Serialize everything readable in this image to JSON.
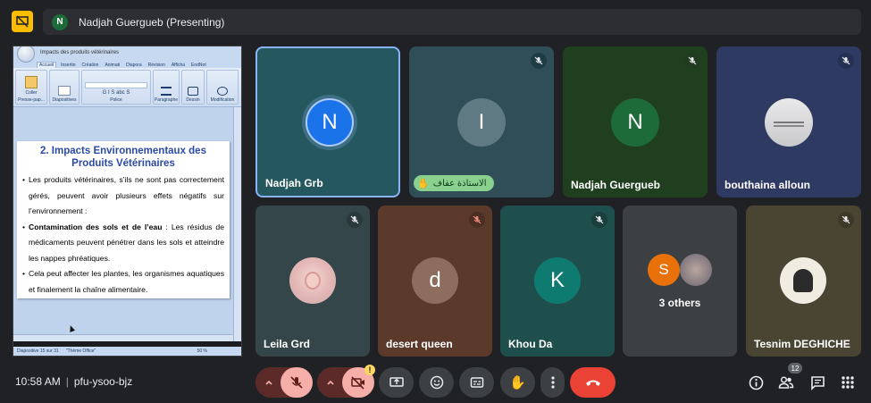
{
  "presenter": {
    "initial": "N",
    "banner": "Nadjah Guergueb (Presenting)"
  },
  "slide": {
    "window_title": "Impacts des produits vétérinaires",
    "tabs": [
      "Accueil",
      "Insertio",
      "Création",
      "Animati",
      "Diapora",
      "Révision",
      "Afficha",
      "EndNot"
    ],
    "groups": [
      "Coller",
      "Diapositives",
      "Police",
      "Paragraphe",
      "Dessin",
      "Modification"
    ],
    "group_captions": [
      "Presse-pap...",
      "",
      "Police",
      "",
      "",
      ""
    ],
    "title_line1": "2. Impacts Environnementaux des",
    "title_line2": "Produits Vétérinaires",
    "bullets": [
      {
        "bold": "",
        "text": "Les produits vétérinaires, s’ils ne sont pas correctement gérés, peuvent avoir plusieurs effets négatifs sur l’environnement :"
      },
      {
        "bold": "Contamination des sols et de l’eau",
        "text": " : Les résidus de médicaments peuvent pénétrer dans les sols et atteindre les nappes phréatiques."
      },
      {
        "bold": "",
        "text": "Cela peut affecter les plantes, les organismes aquatiques et finalement la chaîne alimentaire."
      }
    ],
    "status_left": "Diapositive 15 sur 31",
    "status_theme": "\"Thème Office\"",
    "status_zoom": "50 %"
  },
  "tiles": [
    {
      "name": "Nadjah Grb",
      "initial": "N",
      "muted": false,
      "active": true
    },
    {
      "name": "",
      "initial": "I",
      "muted": true,
      "hand_label": "الاستاذة عفاف"
    },
    {
      "name": "Nadjah Guergueb",
      "initial": "N",
      "muted": true
    },
    {
      "name": "bouthaina alloun",
      "initial": "",
      "muted": true
    },
    {
      "name": "Leila Grd",
      "initial": "",
      "muted": true
    },
    {
      "name": "desert queen",
      "initial": "d",
      "muted": true
    },
    {
      "name": "Khou Da",
      "initial": "K",
      "muted": true
    },
    {
      "name": "3 others",
      "initial": "S",
      "muted": false
    },
    {
      "name": "Tesnim DEGHICHE",
      "initial": "",
      "muted": true
    }
  ],
  "meeting": {
    "time": "10:58 AM",
    "separator": "|",
    "code": "pfu-ysoo-bjz"
  },
  "controls": {
    "cam_warning": "!",
    "people_count": "12"
  },
  "colors": {
    "background": "#202124",
    "hangup": "#ea4335",
    "active_border": "#8ab4f8",
    "mute_red_bg": "#f6aea9"
  }
}
